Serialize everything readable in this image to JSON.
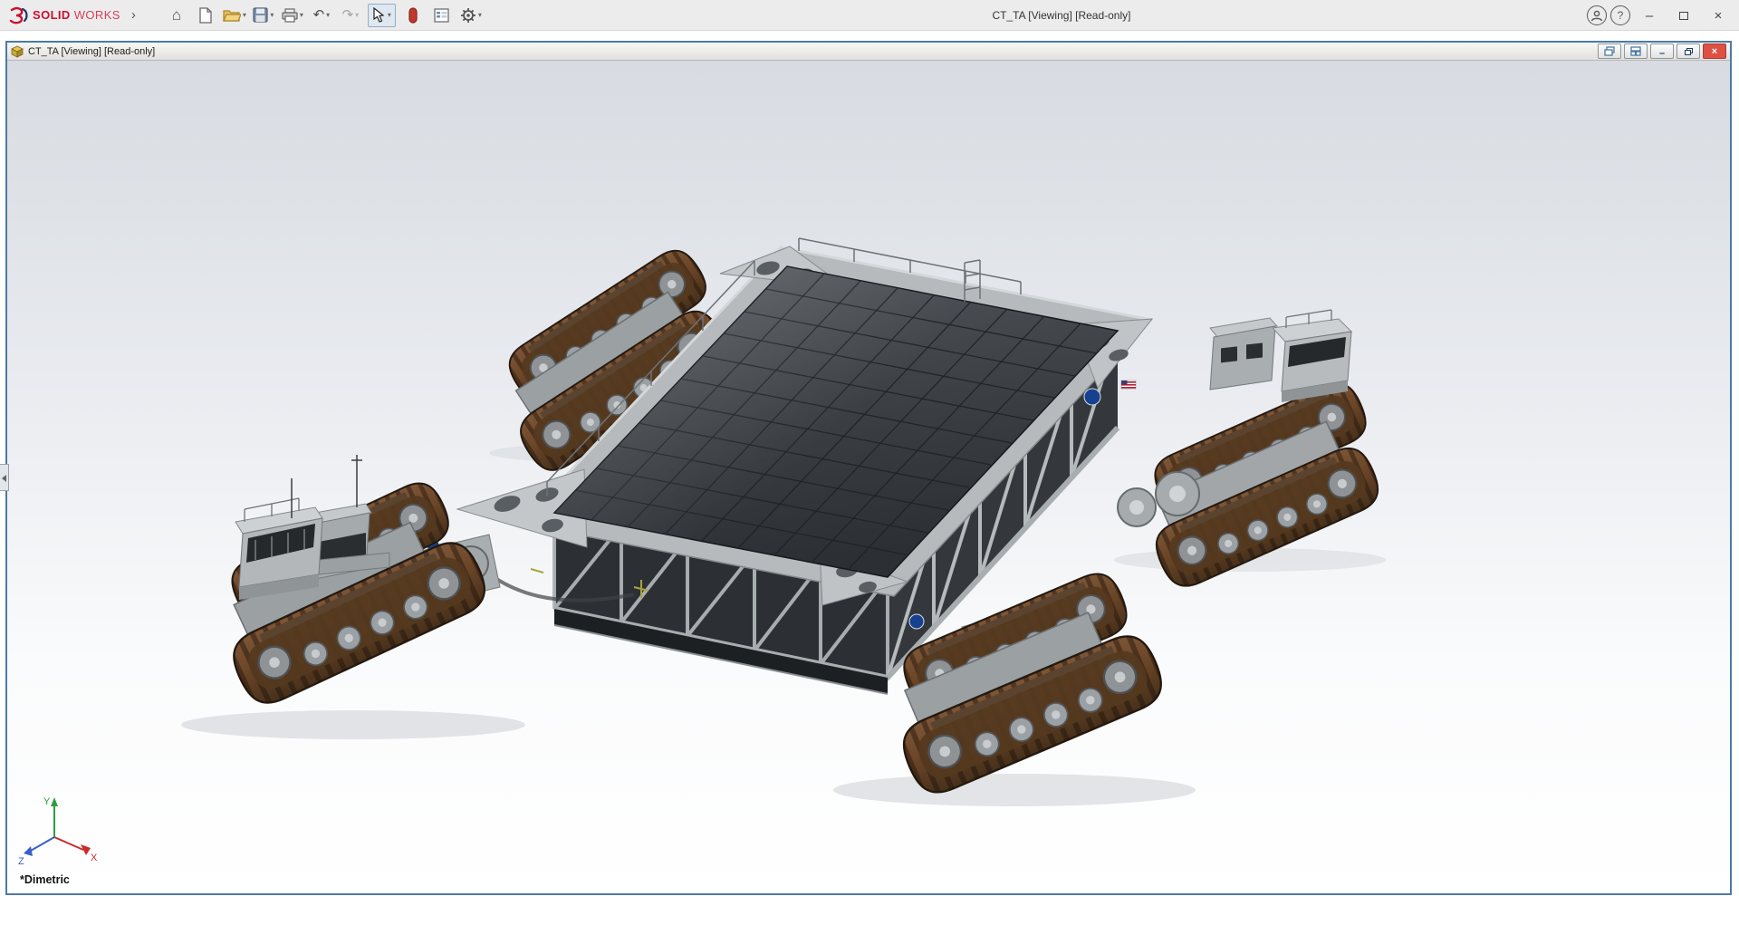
{
  "app_titlebar": {
    "brand": {
      "name_bold": "SOLID",
      "name_light": "WORKS"
    },
    "menu_expand_glyph": "›",
    "title": "CT_TA [Viewing] [Read-only]",
    "window_controls": {
      "minimize_glyph": "–",
      "close_glyph": "×"
    }
  },
  "toolbar": {
    "dropdown_glyph": "▾",
    "help_glyph": "?",
    "items": [
      {
        "id": "home",
        "glyph": "⌂"
      },
      {
        "id": "new-document"
      },
      {
        "id": "open",
        "dropdown": true
      },
      {
        "id": "save",
        "dropdown": true
      },
      {
        "id": "print",
        "dropdown": true
      },
      {
        "id": "undo",
        "glyph": "↶",
        "dropdown": true
      },
      {
        "id": "redo",
        "glyph": "↷",
        "dropdown": true,
        "disabled": true
      },
      {
        "id": "select",
        "dropdown": true,
        "active": true
      },
      {
        "id": "record"
      },
      {
        "id": "file-properties"
      },
      {
        "id": "options",
        "dropdown": true
      }
    ]
  },
  "document_window": {
    "title": "CT_TA [Viewing] [Read-only]",
    "minimize_glyph": "–",
    "close_glyph": "×"
  },
  "viewport": {
    "view_orientation": "*Dimetric",
    "triad": {
      "x_label": "X",
      "y_label": "Y",
      "z_label": "Z"
    }
  },
  "colors": {
    "brand_red": "#c8102e",
    "active_document_border": "#4d7aa3",
    "doc_close_red": "#dd5144",
    "viewport_top": "#d8dbe1",
    "viewport_bottom": "#ffffff",
    "deck_gray": "#3a3e43",
    "frame_gray": "#b6babd",
    "track_brown": "#6b4527",
    "nasa_blue": "#16418f"
  }
}
